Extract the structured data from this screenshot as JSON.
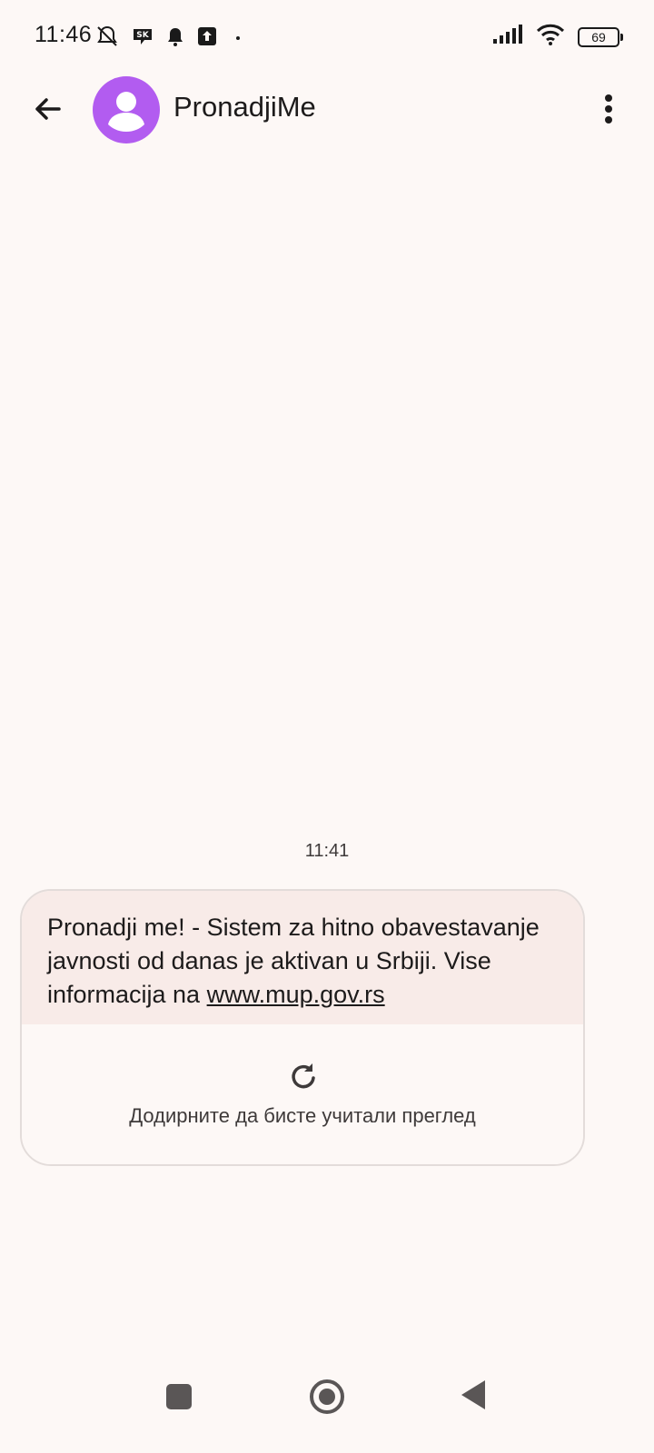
{
  "status_bar": {
    "time": "11:46",
    "battery": "69",
    "icons_left": [
      "notifications-off-icon",
      "sk-app-icon",
      "bell-icon",
      "upload-icon",
      "dot-icon"
    ],
    "icons_right": [
      "signal-icon",
      "wifi-icon",
      "battery-icon"
    ]
  },
  "app_bar": {
    "contact_name": "PronadjiMe"
  },
  "conversation": {
    "timestamp": "11:41",
    "message": {
      "text": "Pronadji me! -  Sistem za hitno obavestavanje javnosti od danas je aktivan u Srbiji. Vise informacija na ",
      "link": "www.mup.gov.rs",
      "preview_label": "Додирните да бисте учитали преглед"
    }
  },
  "colors": {
    "avatar": "#b25cf0",
    "bubble_bg": "#f8ebe8",
    "page_bg": "#fdf8f6"
  }
}
